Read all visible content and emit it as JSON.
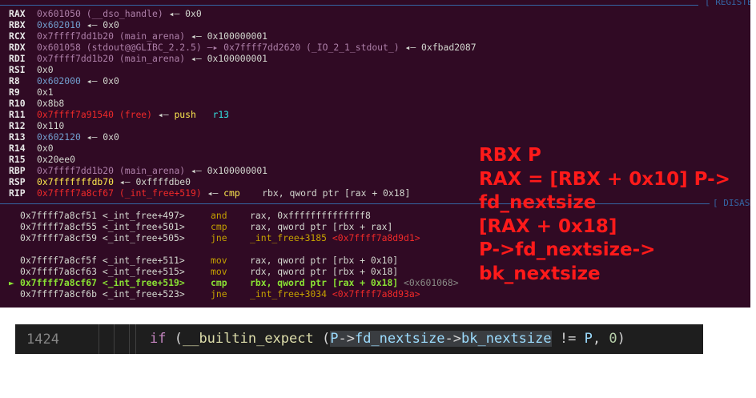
{
  "colors": {
    "terminal_bg": "#300a24",
    "annotation": "#ff1a1a",
    "editor_bg": "#1e1e1e",
    "separator": "#3465a4"
  },
  "registers_header": "[ REGISTERS ]",
  "disasm_header": "[ DISASM ]",
  "registers": [
    {
      "name": "RAX",
      "parts": [
        [
          "p",
          "0x601050 (__dso_handle)"
        ],
        [
          "w",
          " ◂— 0x0"
        ]
      ]
    },
    {
      "name": "RBX",
      "parts": [
        [
          "b",
          "0x602010"
        ],
        [
          "w",
          " ◂— 0x0"
        ]
      ]
    },
    {
      "name": "RCX",
      "parts": [
        [
          "p",
          "0x7ffff7dd1b20 (main_arena)"
        ],
        [
          "w",
          " ◂— 0x100000001"
        ]
      ]
    },
    {
      "name": "RDX",
      "parts": [
        [
          "p",
          "0x601058 (stdout@@GLIBC_2.2.5) —▸ 0x7ffff7dd2620 (_IO_2_1_stdout_)"
        ],
        [
          "w",
          " ◂— 0xfbad2087"
        ]
      ]
    },
    {
      "name": "RDI",
      "parts": [
        [
          "p",
          "0x7ffff7dd1b20 (main_arena)"
        ],
        [
          "w",
          " ◂— 0x100000001"
        ]
      ]
    },
    {
      "name": "RSI",
      "parts": [
        [
          "w",
          "0x0"
        ]
      ]
    },
    {
      "name": "R8",
      "parts": [
        [
          "b",
          "0x602000"
        ],
        [
          "w",
          " ◂— 0x0"
        ]
      ]
    },
    {
      "name": "R9",
      "parts": [
        [
          "w",
          "0x1"
        ]
      ]
    },
    {
      "name": "R10",
      "parts": [
        [
          "w",
          "0x8b8"
        ]
      ]
    },
    {
      "name": "R11",
      "parts": [
        [
          "r",
          "0x7ffff7a91540 (free)"
        ],
        [
          "w",
          " ◂— "
        ],
        [
          "y",
          "push"
        ],
        [
          "w",
          "   "
        ],
        [
          "c",
          "r13"
        ]
      ]
    },
    {
      "name": "R12",
      "parts": [
        [
          "w",
          "0x110"
        ]
      ]
    },
    {
      "name": "R13",
      "parts": [
        [
          "b",
          "0x602120"
        ],
        [
          "w",
          " ◂— 0x0"
        ]
      ]
    },
    {
      "name": "R14",
      "parts": [
        [
          "w",
          "0x0"
        ]
      ]
    },
    {
      "name": "R15",
      "parts": [
        [
          "w",
          "0x20ee0"
        ]
      ]
    },
    {
      "name": "RBP",
      "parts": [
        [
          "p",
          "0x7ffff7dd1b20 (main_arena)"
        ],
        [
          "w",
          " ◂— 0x100000001"
        ]
      ]
    },
    {
      "name": "RSP",
      "parts": [
        [
          "y",
          "0x7fffffffdb70"
        ],
        [
          "w",
          " ◂— 0xffffdbe0"
        ]
      ]
    },
    {
      "name": "RIP",
      "parts": [
        [
          "r",
          "0x7ffff7a8cf67 (_int_free+519)"
        ],
        [
          "w",
          " ◂— "
        ],
        [
          "y",
          "cmp"
        ],
        [
          "w",
          "    rbx, qword ptr [rax + 0x18]"
        ]
      ]
    }
  ],
  "disasm": [
    {
      "current": false,
      "addr": "0x7ffff7a8cf51 <_int_free+497>",
      "mn": "and",
      "ops": "rax, 0xffffffffffffff8",
      "tail": ""
    },
    {
      "current": false,
      "addr": "0x7ffff7a8cf55 <_int_free+501>",
      "mn": "cmp",
      "ops": "rax, qword ptr [rbx + rax]",
      "tail": ""
    },
    {
      "current": false,
      "addr": "0x7ffff7a8cf59 <_int_free+505>",
      "mn": "jne",
      "ops": "_int_free+3185 ",
      "tail": "<0x7ffff7a8d9d1>"
    },
    {
      "current": false,
      "addr": "0x7ffff7a8cf5f <_int_free+511>",
      "mn": "mov",
      "ops": "rax, qword ptr [rbx + 0x10]",
      "tail": ""
    },
    {
      "current": false,
      "addr": "0x7ffff7a8cf63 <_int_free+515>",
      "mn": "mov",
      "ops": "rdx, qword ptr [rbx + 0x18]",
      "tail": ""
    },
    {
      "current": true,
      "addr": "0x7ffff7a8cf67 <_int_free+519>",
      "mn": "cmp",
      "ops": "rbx, qword ptr [rax + 0x18] ",
      "tail": "<0x601068>"
    },
    {
      "current": false,
      "addr": "0x7ffff7a8cf6b <_int_free+523>",
      "mn": "jne",
      "ops": "_int_free+3034 ",
      "tail": "<0x7ffff7a8d93a>"
    }
  ],
  "annotation_lines": [
    "RBX P",
    "RAX = [RBX + 0x10] P->",
    "fd_nextsize",
    "[RAX + 0x18]",
    "P->fd_nextsize->",
    "bk_nextsize"
  ],
  "editor": {
    "line_number": "1424",
    "tokens": [
      [
        "kw",
        "if"
      ],
      [
        "d",
        " ("
      ],
      [
        "fn",
        "__builtin_expect"
      ],
      [
        "d",
        " ("
      ],
      [
        "idh",
        "P"
      ],
      [
        "dh",
        "->"
      ],
      [
        "idh",
        "fd_nextsize"
      ],
      [
        "dh",
        "->"
      ],
      [
        "idh",
        "bk_nextsize"
      ],
      [
        "d",
        " != "
      ],
      [
        "id",
        "P"
      ],
      [
        "d",
        ", "
      ],
      [
        "num",
        "0"
      ],
      [
        "d",
        ")"
      ]
    ]
  }
}
